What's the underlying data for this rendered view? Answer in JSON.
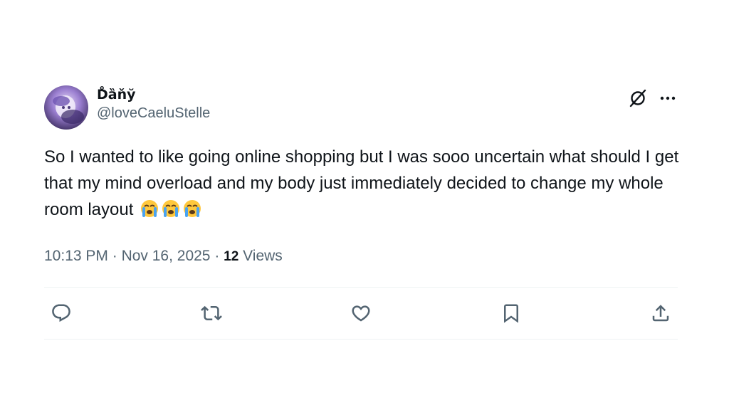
{
  "author": {
    "display_name": "D̊ȁňy̆",
    "handle": "@loveCaeluStelle"
  },
  "header_icons": [
    "grok-icon",
    "more-icon"
  ],
  "tweet": {
    "text": "So I wanted to like going online shopping but I was sooo uncertain what should I get that my mind overload and my body just immediately decided to change my whole room layout",
    "emojis": [
      "😭",
      "😭",
      "😭"
    ]
  },
  "meta": {
    "time": "10:13 PM",
    "separator1": " · ",
    "date": "Nov 16, 2025",
    "separator2": " · ",
    "views_count": "12",
    "views_label": " Views"
  },
  "actions": [
    "reply-icon",
    "retweet-icon",
    "like-icon",
    "bookmark-icon",
    "share-icon"
  ],
  "colors": {
    "text_primary": "#0f1419",
    "text_secondary": "#536471",
    "divider": "#eff3f4"
  }
}
